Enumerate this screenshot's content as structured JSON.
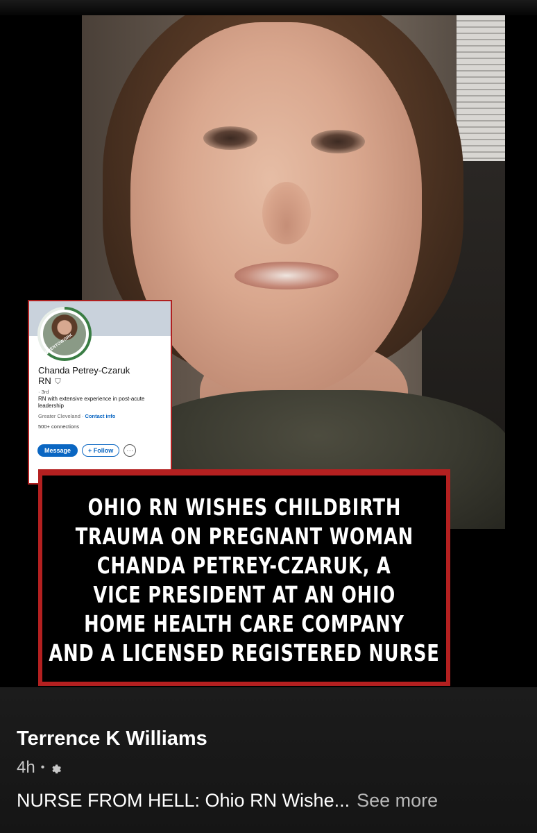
{
  "profile_card": {
    "badge_text": "#OPENTOWORK",
    "name": "Chanda Petrey-Czaruk",
    "name_suffix": "RN",
    "degree": "· 3rd",
    "headline": "RN with extensive experience in post-acute leadership",
    "location": "Greater Cleveland ·",
    "contact_link": "Contact info",
    "connections": "500+ connections",
    "message_label": "Message",
    "follow_label": "+ Follow",
    "more_label": "···"
  },
  "headline_lines": [
    "OHIO RN WISHES CHILDBIRTH",
    "TRAUMA ON PREGNANT WOMAN",
    "CHANDA PETREY-CZARUK, A",
    "VICE PRESIDENT AT AN OHIO",
    "HOME HEALTH CARE COMPANY",
    "AND A LICENSED REGISTERED NURSE"
  ],
  "post": {
    "author": "Terrence K Williams",
    "time": "4h",
    "separator": "•",
    "privacy_icon": "gear-icon",
    "caption": "NURSE FROM HELL: Ohio RN Wishe...",
    "see_more": "See more"
  },
  "colors": {
    "frame_red": "#b42020",
    "linkedin_blue": "#0a66c2",
    "footer_bg": "#1c1c1c"
  }
}
